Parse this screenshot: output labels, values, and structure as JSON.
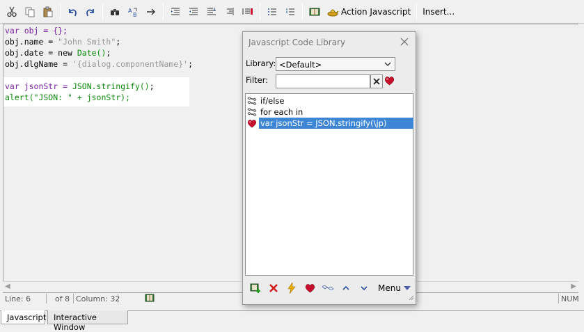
{
  "toolbar": {
    "buttons": [
      "cut-icon",
      "copy-icon",
      "paste-icon",
      "undo-icon",
      "redo-icon",
      "find-icon",
      "replace-icon",
      "goto-icon",
      "indent-icon",
      "outdent-icon",
      "format-icon",
      "align-right-icon",
      "comment-icon",
      "list-icon",
      "numbered-list-icon",
      "library-icon"
    ],
    "action_javascript": "Action Javascript",
    "insert": "Insert..."
  },
  "editor": {
    "lines": [
      [
        {
          "t": "var obj = {};",
          "c": "kw"
        }
      ],
      [
        {
          "t": "obj.name = ",
          "c": "pl"
        },
        {
          "t": "\"John Smith\"",
          "c": "str"
        },
        {
          "t": ";",
          "c": "pl"
        }
      ],
      [
        {
          "t": "obj.date = new ",
          "c": "pl"
        },
        {
          "t": "Date()",
          "c": "fn"
        },
        {
          "t": ";",
          "c": "pl"
        }
      ],
      [
        {
          "t": "obj.dlgName = ",
          "c": "pl"
        },
        {
          "t": "'{dialog.componentName}'",
          "c": "str"
        },
        {
          "t": ";",
          "c": "pl"
        }
      ],
      [
        {
          "t": "",
          "c": "pl"
        }
      ],
      [
        {
          "t": "var jsonStr = ",
          "c": "kw"
        },
        {
          "t": "JSON.stringify()",
          "c": "fn"
        },
        {
          "t": ";",
          "c": "pl"
        }
      ],
      [
        {
          "t": "alert(\"JSON: \" + jsonStr);",
          "c": "fn"
        }
      ]
    ]
  },
  "status": {
    "line": "Line: 6",
    "of": "of 8",
    "column": "Column: 32",
    "mode": "NUM"
  },
  "tabs": [
    {
      "label": "Javascript",
      "active": true
    },
    {
      "label": "Interactive Window",
      "active": false
    }
  ],
  "library_dialog": {
    "title": "Javascript Code Library",
    "library_label": "Library:",
    "library_value": "<Default>",
    "filter_label": "Filter:",
    "filter_value": "",
    "items": [
      {
        "label": "if/else",
        "icon": "snippet-icon",
        "selected": false
      },
      {
        "label": "for each in",
        "icon": "snippet-icon",
        "selected": false
      },
      {
        "label": "var jsonStr = JSON.stringify(\\jp)",
        "icon": "favorite-heart-icon",
        "selected": true
      }
    ],
    "menu_label": "Menu"
  },
  "colors": {
    "keyword": "#7b1fa2",
    "string": "#9a9a9a",
    "function": "#0a8a0a",
    "selection": "#3e85d6",
    "heart": "#c8102e"
  }
}
